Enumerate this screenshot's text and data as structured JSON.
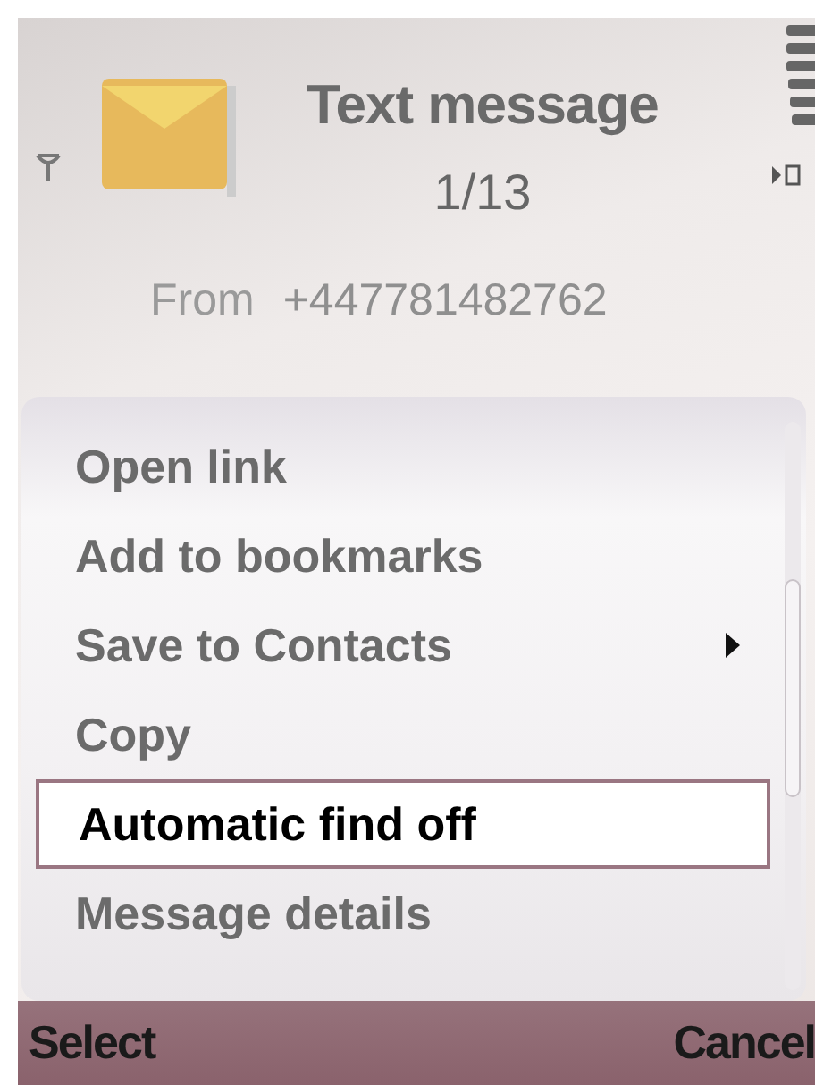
{
  "header": {
    "title": "Text message",
    "counter": "1/13",
    "from_label": "From",
    "from_number": "+447781482762"
  },
  "menu": {
    "items": [
      {
        "label": "Open link",
        "selected": false,
        "submenu": false
      },
      {
        "label": "Add to bookmarks",
        "selected": false,
        "submenu": false
      },
      {
        "label": "Save to Contacts",
        "selected": false,
        "submenu": true
      },
      {
        "label": "Copy",
        "selected": false,
        "submenu": false
      },
      {
        "label": "Automatic find off",
        "selected": true,
        "submenu": false
      },
      {
        "label": "Message details",
        "selected": false,
        "submenu": false
      }
    ]
  },
  "softkeys": {
    "left": "Select",
    "right": "Cancel"
  }
}
